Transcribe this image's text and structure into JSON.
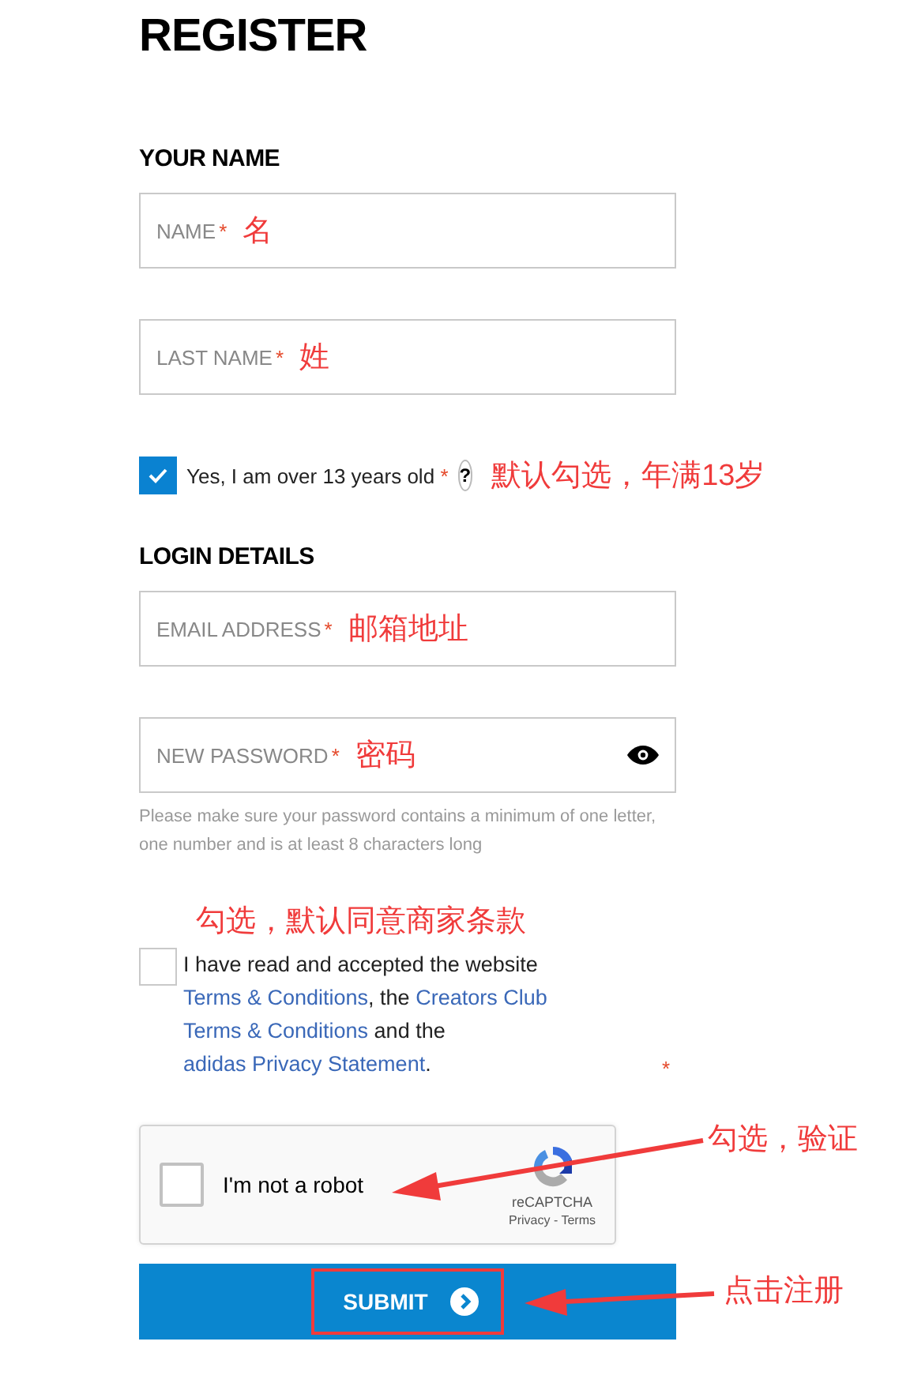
{
  "title": "REGISTER",
  "sections": [
    {
      "heading": "YOUR NAME",
      "items": [
        {
          "kind": "field",
          "label": "NAME",
          "required": "*",
          "note": "名"
        },
        {
          "kind": "field",
          "label": "LAST NAME",
          "required": "*",
          "note": "姓"
        },
        {
          "kind": "checkbox",
          "checked": true,
          "label": "Yes, I am over 13 years old",
          "required": "*",
          "help": "?",
          "note": "默认勾选，年满13岁"
        }
      ]
    },
    {
      "heading": "LOGIN DETAILS",
      "items": [
        {
          "kind": "field",
          "label": "EMAIL ADDRESS",
          "required": "*",
          "note": "邮箱地址"
        },
        {
          "kind": "password",
          "label": "NEW PASSWORD",
          "required": "*",
          "note": "密码",
          "hint": "Please make sure your password contains a minimum of one letter, one number and is at least 8 characters long"
        }
      ]
    }
  ],
  "terms": {
    "note": "勾选，默认同意商家条款",
    "checked": false,
    "required": "*",
    "segments": [
      {
        "kind": "text",
        "text": "I have read and accepted the website "
      },
      {
        "kind": "link",
        "text": "Terms & Conditions"
      },
      {
        "kind": "text",
        "text": ", the "
      },
      {
        "kind": "link",
        "text": "Creators Club"
      },
      {
        "kind": "link",
        "text": "Terms & Conditions"
      },
      {
        "kind": "text",
        "text": " and the "
      },
      {
        "kind": "link",
        "text": "adidas Privacy Statement"
      },
      {
        "kind": "text",
        "text": "."
      }
    ]
  },
  "captcha": {
    "label": "I'm not a robot",
    "checked": false,
    "brand": "reCAPTCHA",
    "links": "Privacy - Terms",
    "note": "勾选，验证"
  },
  "submit": {
    "label": "SUBMIT",
    "note": "点击注册"
  }
}
